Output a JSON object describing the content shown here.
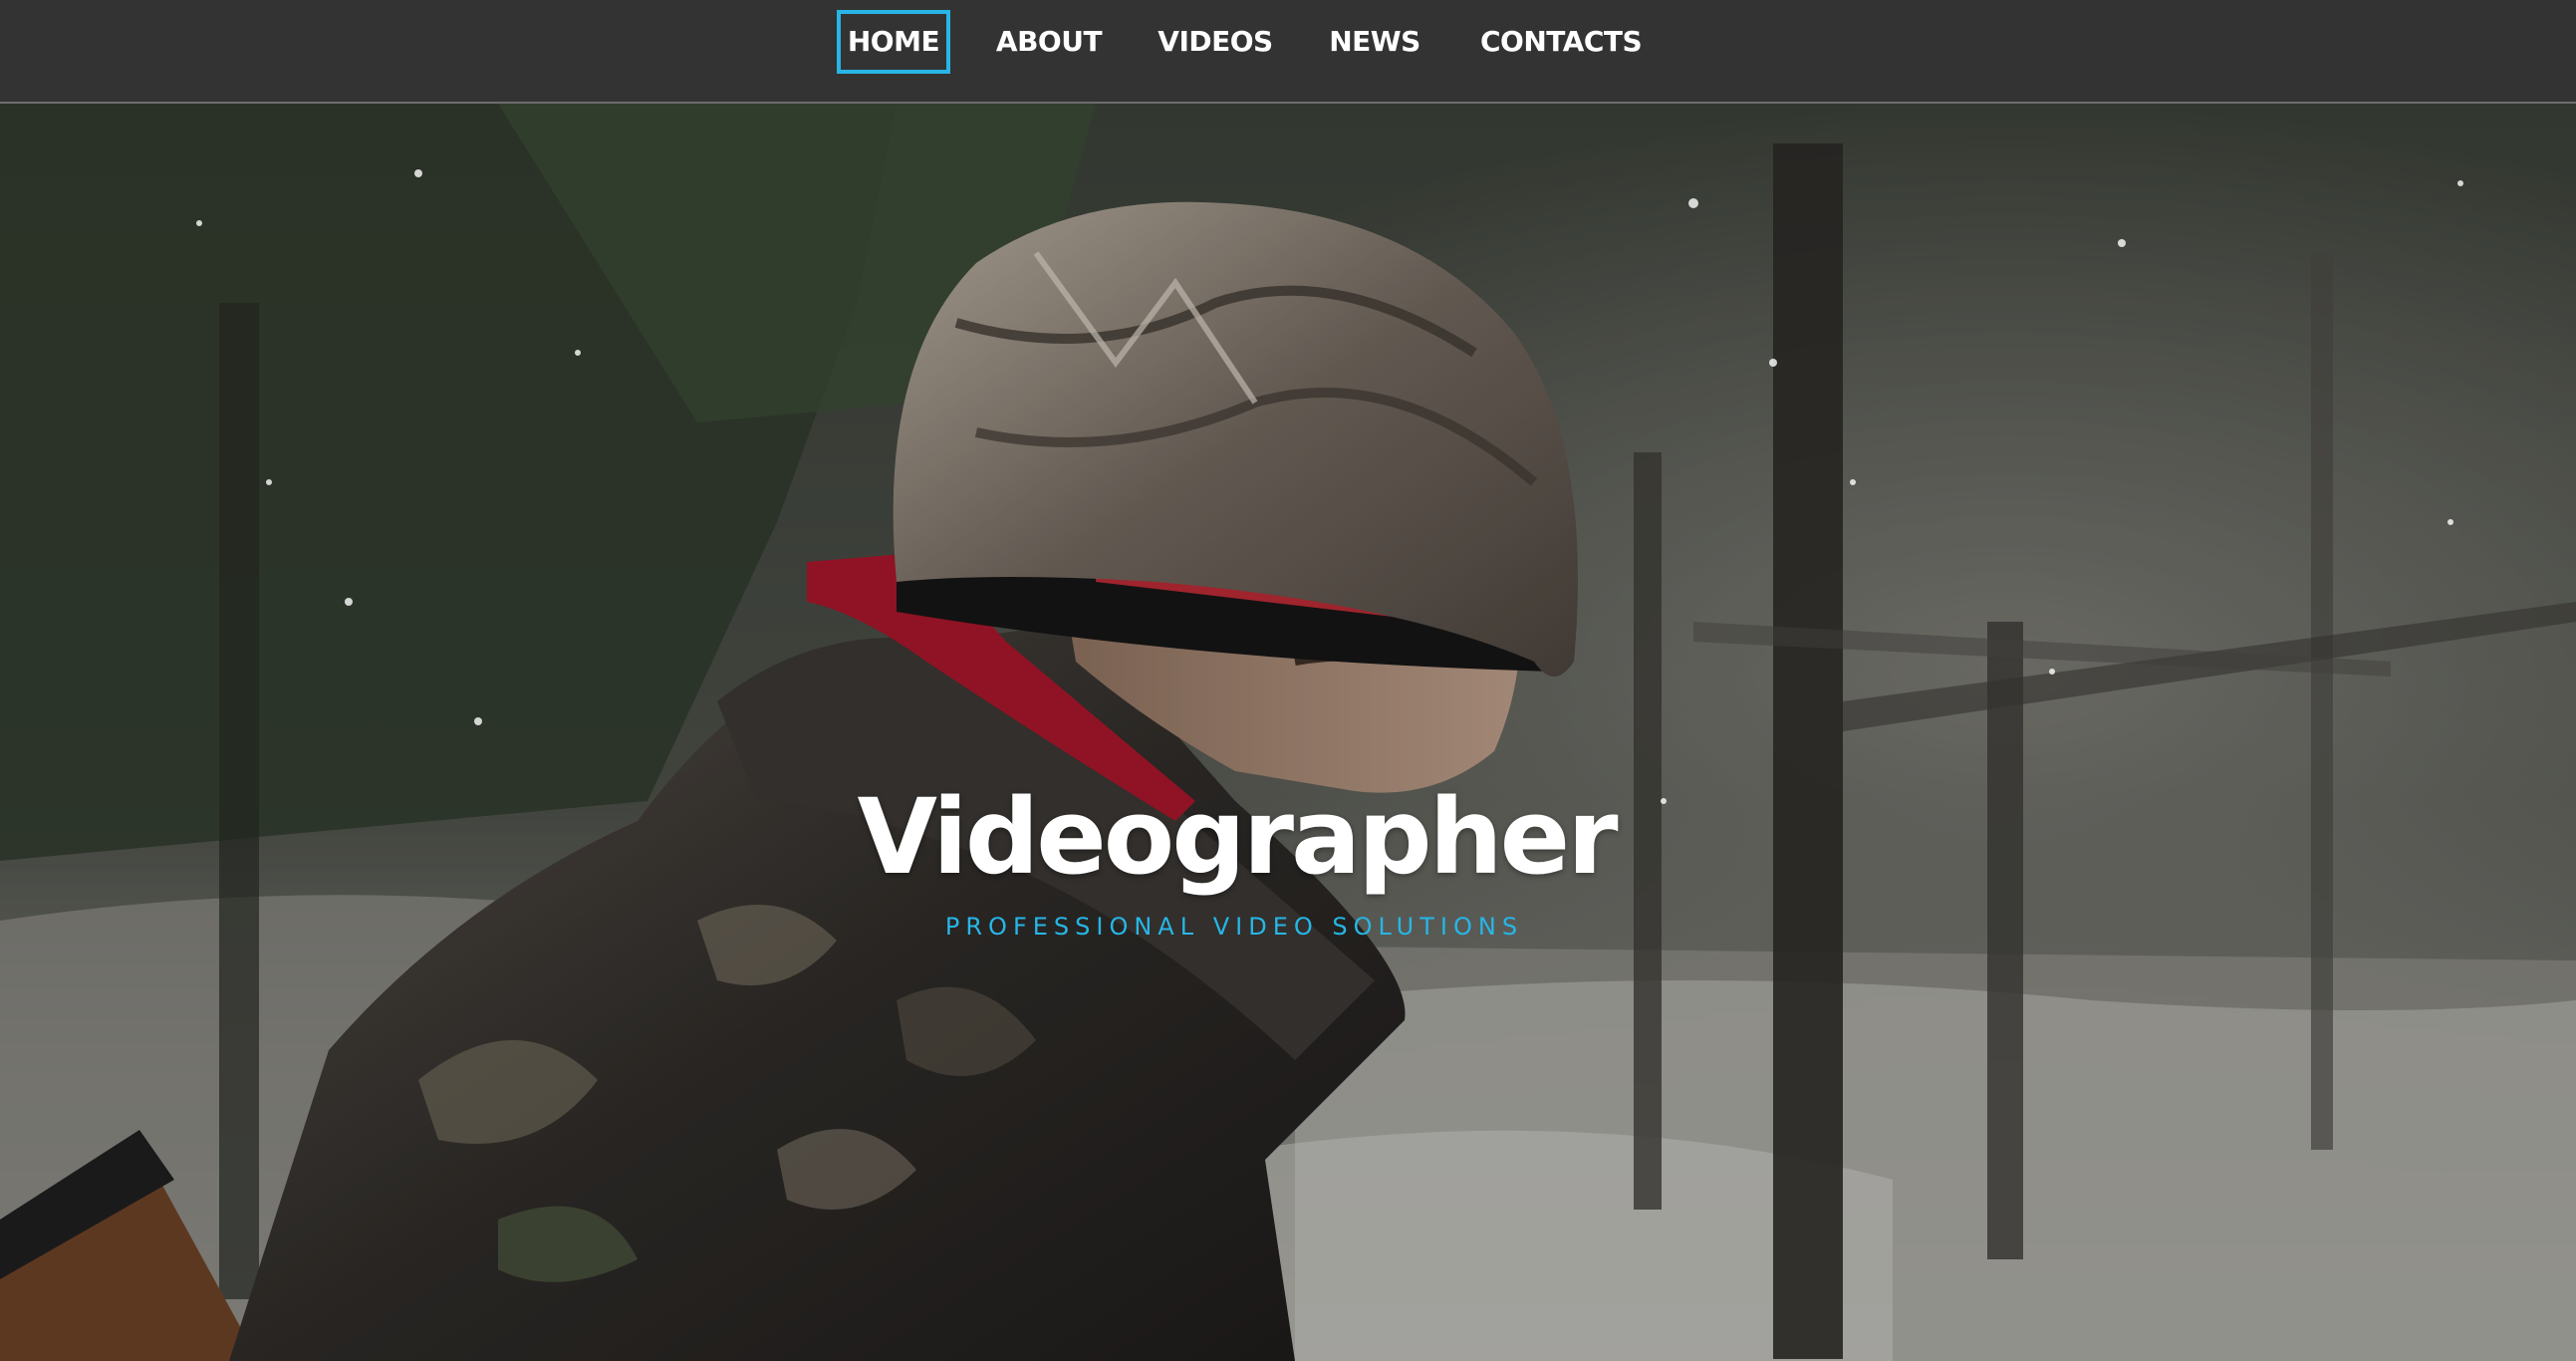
{
  "nav": {
    "items": [
      {
        "label": "HOME",
        "active": true
      },
      {
        "label": "ABOUT",
        "active": false
      },
      {
        "label": "VIDEOS",
        "active": false
      },
      {
        "label": "NEWS",
        "active": false
      },
      {
        "label": "CONTACTS",
        "active": false
      }
    ]
  },
  "hero": {
    "title": "Videographer",
    "subtitle": "PROFESSIONAL VIDEO SOLUTIONS"
  },
  "colors": {
    "accent": "#27b6e6",
    "navbar_bg": "#333333",
    "text": "#ffffff"
  }
}
